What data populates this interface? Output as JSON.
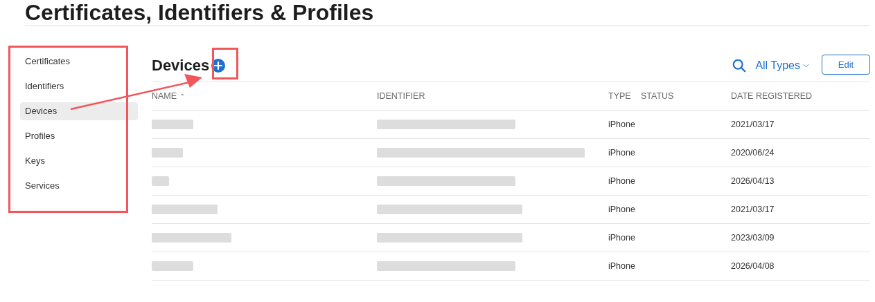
{
  "page_title": "Certificates, Identifiers & Profiles",
  "sidebar": {
    "items": [
      {
        "label": "Certificates",
        "selected": false
      },
      {
        "label": "Identifiers",
        "selected": false
      },
      {
        "label": "Devices",
        "selected": true
      },
      {
        "label": "Profiles",
        "selected": false
      },
      {
        "label": "Keys",
        "selected": false
      },
      {
        "label": "Services",
        "selected": false
      }
    ]
  },
  "section": {
    "title": "Devices",
    "filter": "All Types",
    "edit_button": "Edit"
  },
  "table": {
    "columns": [
      "NAME",
      "IDENTIFIER",
      "TYPE",
      "STATUS",
      "DATE REGISTERED"
    ],
    "sort_indicator": "⌃",
    "rows": [
      {
        "type": "iPhone",
        "date": "2021/03/17"
      },
      {
        "type": "iPhone",
        "date": "2020/06/24"
      },
      {
        "type": "iPhone",
        "date": "2026/04/13"
      },
      {
        "type": "iPhone",
        "date": "2021/03/17"
      },
      {
        "type": "iPhone",
        "date": "2023/03/09"
      },
      {
        "type": "iPhone",
        "date": "2026/04/08"
      }
    ]
  }
}
